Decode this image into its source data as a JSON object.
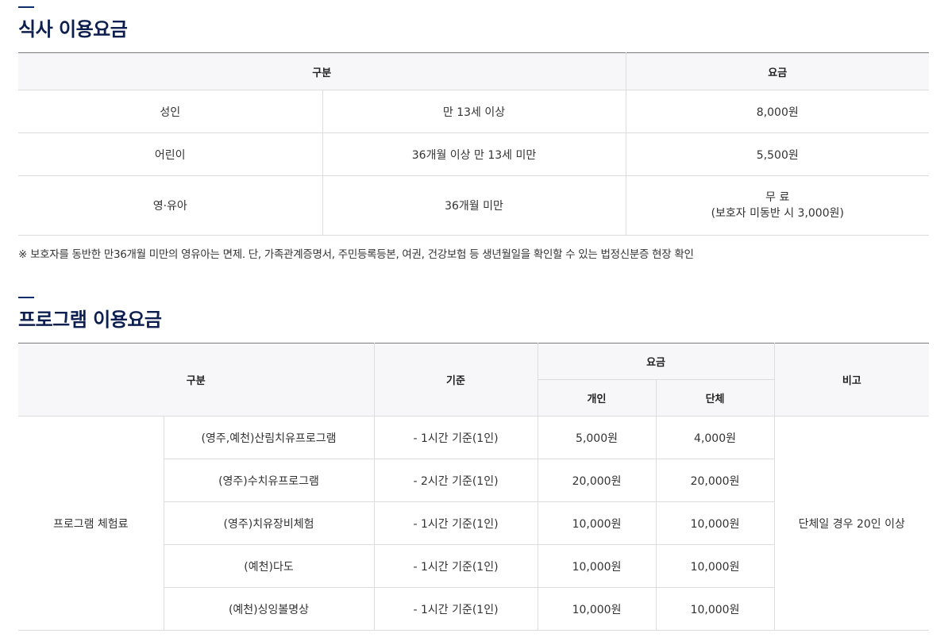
{
  "meal": {
    "title": "식사 이용요금",
    "headers": {
      "category": "구분",
      "fee": "요금"
    },
    "rows": [
      {
        "name": "성인",
        "criteria": "만 13세 이상",
        "fee": "8,000원",
        "fee_note": ""
      },
      {
        "name": "어린이",
        "criteria": "36개월 이상 만 13세 미만",
        "fee": "5,500원",
        "fee_note": ""
      },
      {
        "name": "영·유아",
        "criteria": "36개월 미만",
        "fee": "무 료",
        "fee_note": "(보호자 미동반 시 3,000원)"
      }
    ],
    "note": "※ 보호자를 동반한 만36개월 미만의 영유아는 면제. 단, 가족관계증명서, 주민등록등본, 여권, 건강보험 등 생년월일을 확인할 수 있는 법정신분증 현장 확인"
  },
  "program": {
    "title": "프로그램 이용요금",
    "headers": {
      "category": "구분",
      "criteria": "기준",
      "fee": "요금",
      "individual": "개인",
      "group": "단체",
      "remark": "비고"
    },
    "category_label": "프로그램 체험료",
    "remark_value": "단체일 경우 20인 이상",
    "rows": [
      {
        "name": "(영주,예천)산림치유프로그램",
        "criteria": "- 1시간 기준(1인)",
        "individual": "5,000원",
        "group": "4,000원"
      },
      {
        "name": "(영주)수치유프로그램",
        "criteria": "- 2시간 기준(1인)",
        "individual": "20,000원",
        "group": "20,000원"
      },
      {
        "name": "(영주)치유장비체험",
        "criteria": "- 1시간 기준(1인)",
        "individual": "10,000원",
        "group": "10,000원"
      },
      {
        "name": "(예천)다도",
        "criteria": "- 1시간 기준(1인)",
        "individual": "10,000원",
        "group": "10,000원"
      },
      {
        "name": "(예천)싱잉볼명상",
        "criteria": "- 1시간 기준(1인)",
        "individual": "10,000원",
        "group": "10,000원"
      }
    ]
  }
}
